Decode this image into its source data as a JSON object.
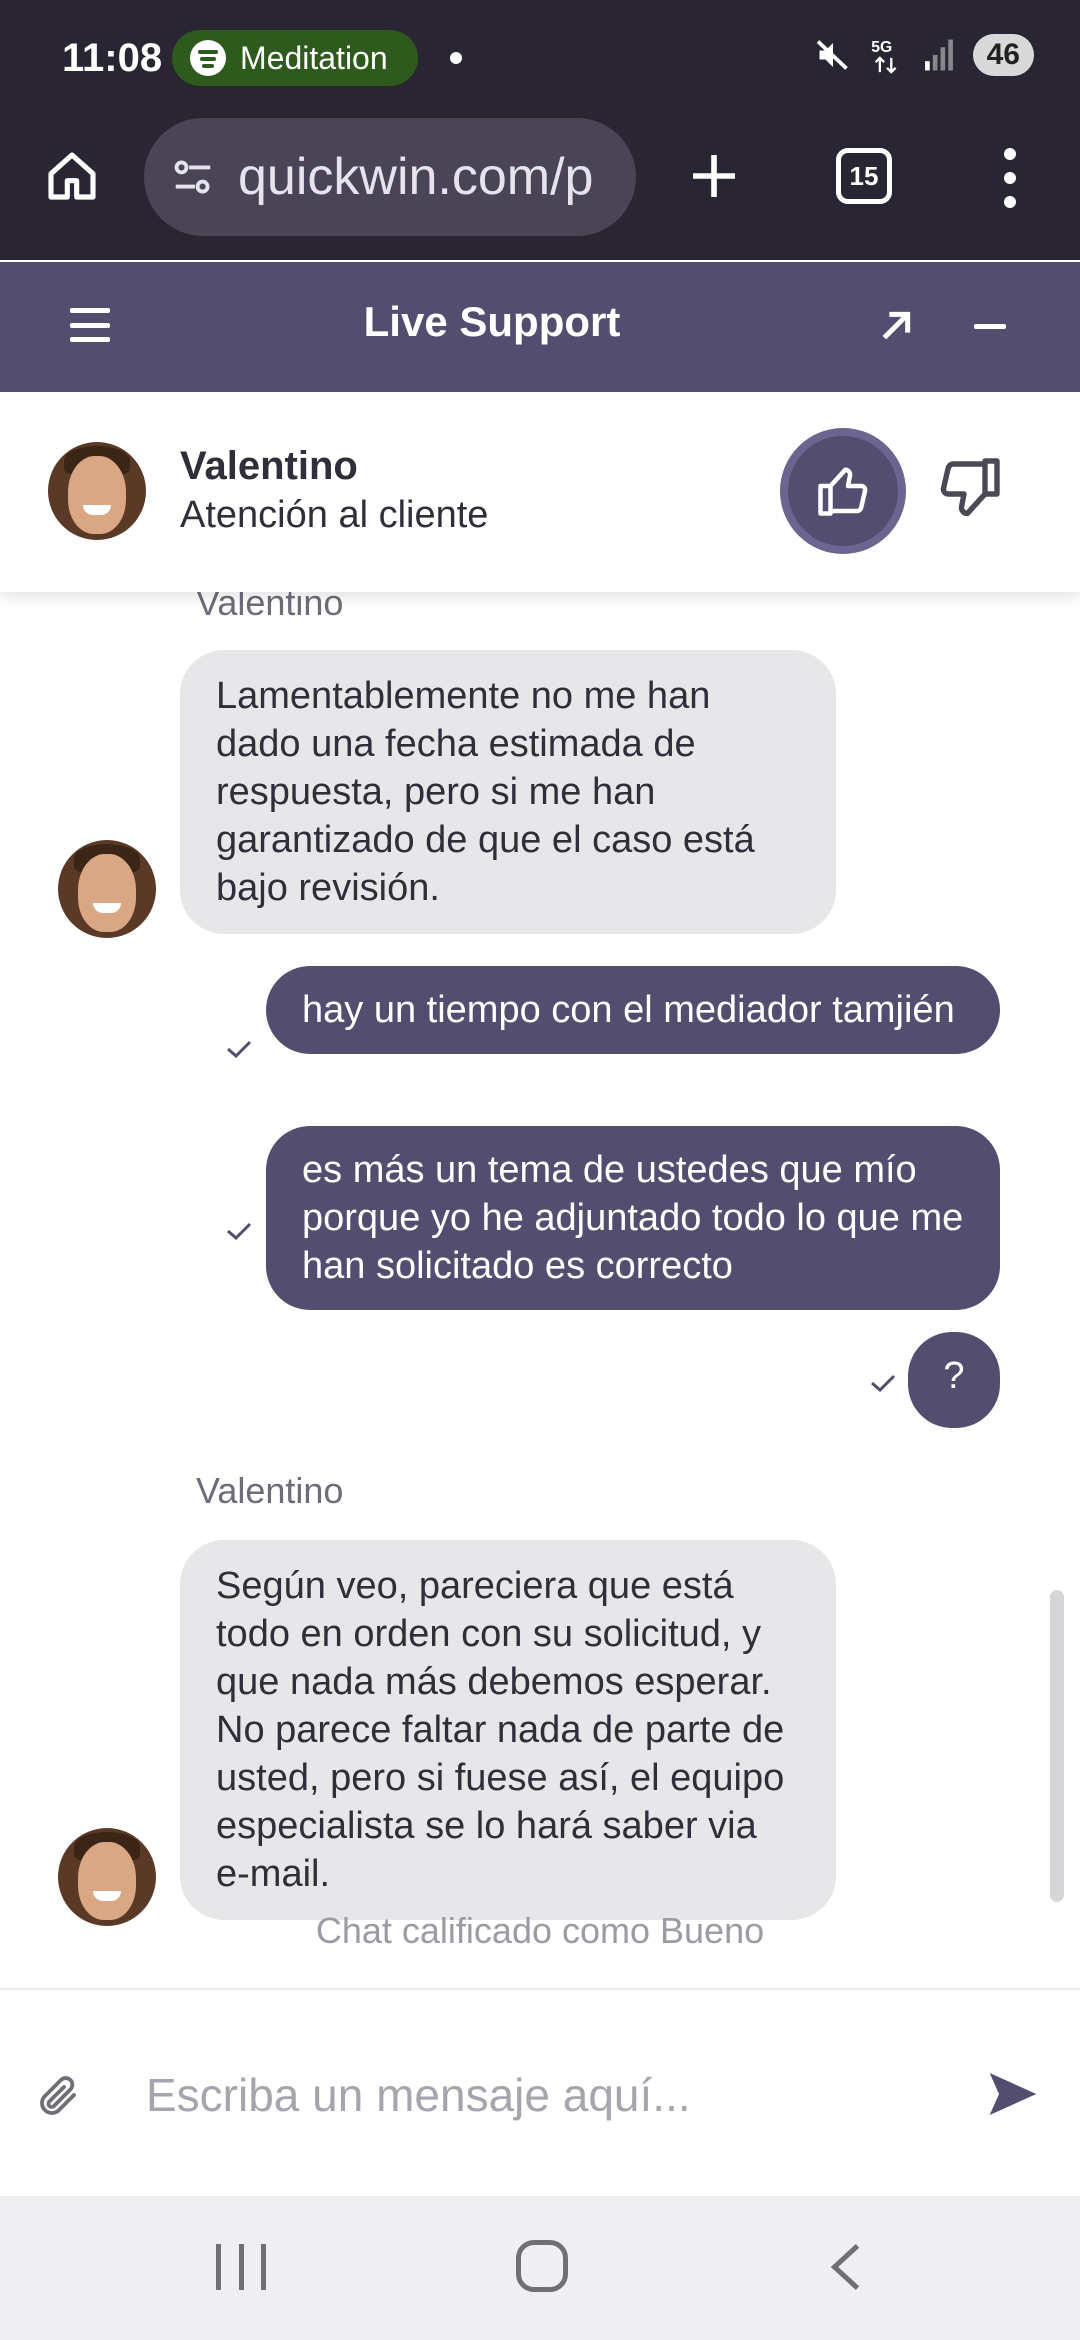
{
  "status_bar": {
    "time": "11:08",
    "media_label": "Meditation",
    "battery": "46",
    "icons": [
      "spotify-icon",
      "mute-icon",
      "5g-icon",
      "signal-icon",
      "battery-icon"
    ]
  },
  "browser": {
    "url": "quickwin.com/p",
    "tab_count": "15",
    "icons": [
      "home-icon",
      "site-settings-icon",
      "plus-icon",
      "tabs-icon",
      "more-icon"
    ]
  },
  "support_header": {
    "title": "Live Support"
  },
  "agent": {
    "name": "Valentino",
    "role": "Atención al cliente"
  },
  "chat": {
    "messages": [
      {
        "from": "agent",
        "sender": "Valentino",
        "text": "Lamentablemente no me han dado una fecha estimada de respuesta, pero si me han garantizado de que el caso está bajo revisión."
      },
      {
        "from": "user",
        "text": "hay un tiempo con el mediador tamjién"
      },
      {
        "from": "user",
        "text": "es más un tema de ustedes que mío porque yo he adjuntado todo lo que me han solicitado es correcto"
      },
      {
        "from": "user",
        "text": "?"
      },
      {
        "from": "agent",
        "sender": "Valentino",
        "text": "Según veo, pareciera que está todo en orden con su solicitud, y que nada más debemos esperar. No parece faltar nada de parte de usted, pero si fuese así, el equipo especialista se lo hará saber via e-mail."
      }
    ],
    "rated_note": "Chat calificado como Bueno"
  },
  "input": {
    "placeholder": "Escriba un mensaje aquí..."
  },
  "colors": {
    "brand": "#534d70",
    "chrome": "#2a2533",
    "agent_bubble": "#e7e7ea"
  }
}
